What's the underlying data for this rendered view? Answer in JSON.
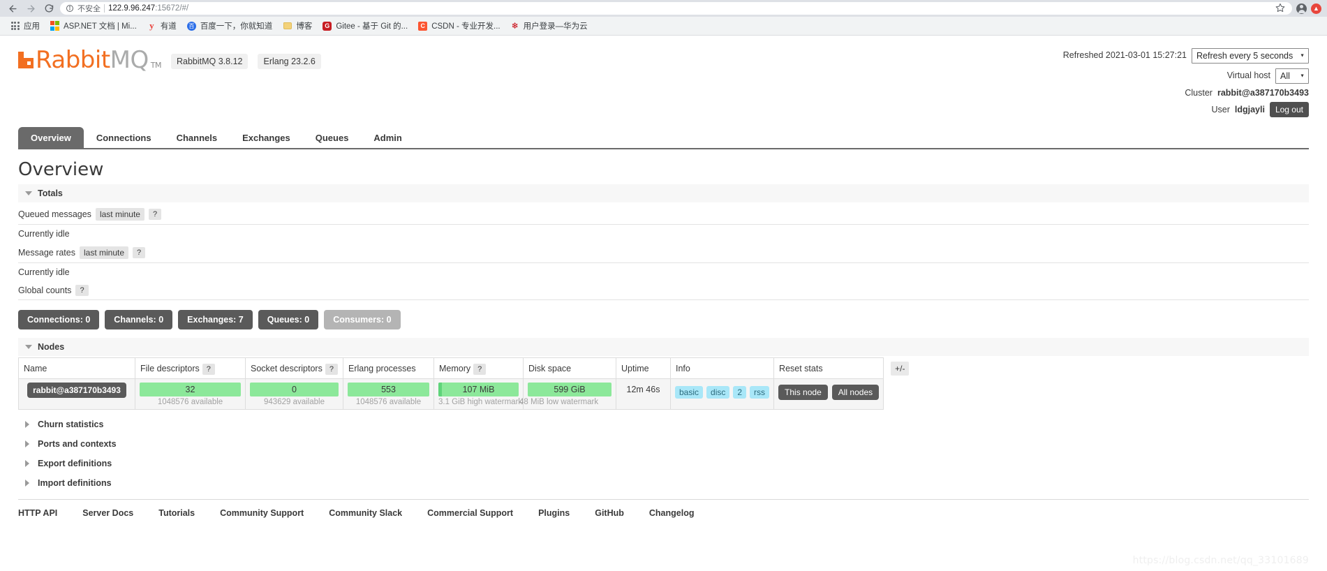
{
  "browser": {
    "back_icon": "back-arrow-icon",
    "forward_icon": "forward-arrow-icon",
    "reload_icon": "reload-icon",
    "security_label": "不安全",
    "url_host": "122.9.96.247",
    "url_rest": ":15672/#/",
    "star_icon": "bookmark-star-icon",
    "profile_icon": "profile-avatar-icon",
    "update_icon": "update-available-icon",
    "bookmarks": [
      {
        "label": "应用",
        "icon": "apps-grid-icon"
      },
      {
        "label": "ASP.NET 文档 | Mi...",
        "icon": "microsoft-icon"
      },
      {
        "label": "有道",
        "icon": "youdao-icon"
      },
      {
        "label": "百度一下，你就知道",
        "icon": "baidu-icon"
      },
      {
        "label": "博客",
        "icon": "folder-icon"
      },
      {
        "label": "Gitee - 基于 Git 的...",
        "icon": "gitee-icon"
      },
      {
        "label": "CSDN - 专业开发...",
        "icon": "csdn-icon"
      },
      {
        "label": "用户登录—华为云",
        "icon": "huawei-icon"
      }
    ]
  },
  "header": {
    "logo_orange": "Rabbit",
    "logo_gray": "MQ",
    "trademark": "TM",
    "version_pill": "RabbitMQ 3.8.12",
    "erlang_pill": "Erlang 23.2.6",
    "refreshed_label": "Refreshed 2021-03-01 15:27:21",
    "refresh_select_value": "Refresh every 5 seconds",
    "refresh_options": [
      "Refresh every 5 seconds"
    ],
    "vhost_label": "Virtual host",
    "vhost_value": "All",
    "vhost_options": [
      "All"
    ],
    "cluster_label": "Cluster",
    "cluster_value": "rabbit@a387170b3493",
    "user_label": "User",
    "user_value": "ldgjayli",
    "logout_label": "Log out"
  },
  "tabs": [
    {
      "label": "Overview",
      "active": true
    },
    {
      "label": "Connections",
      "active": false
    },
    {
      "label": "Channels",
      "active": false
    },
    {
      "label": "Exchanges",
      "active": false
    },
    {
      "label": "Queues",
      "active": false
    },
    {
      "label": "Admin",
      "active": false
    }
  ],
  "main": {
    "page_title": "Overview",
    "totals": {
      "section_label": "Totals",
      "queued_messages_label": "Queued messages",
      "queued_messages_chip": "last minute",
      "queued_messages_help": "?",
      "queued_messages_status": "Currently idle",
      "message_rates_label": "Message rates",
      "message_rates_chip": "last minute",
      "message_rates_help": "?",
      "message_rates_status": "Currently idle",
      "global_counts_label": "Global counts",
      "global_counts_help": "?"
    },
    "counts": [
      {
        "label": "Connections: 0",
        "disabled": false
      },
      {
        "label": "Channels: 0",
        "disabled": false
      },
      {
        "label": "Exchanges: 7",
        "disabled": false
      },
      {
        "label": "Queues: 0",
        "disabled": false
      },
      {
        "label": "Consumers: 0",
        "disabled": true
      }
    ],
    "nodes": {
      "section_label": "Nodes",
      "columns": {
        "name": "Name",
        "file_descriptors": "File descriptors",
        "file_descriptors_help": "?",
        "socket_descriptors": "Socket descriptors",
        "socket_descriptors_help": "?",
        "erlang_processes": "Erlang processes",
        "memory": "Memory",
        "memory_help": "?",
        "disk_space": "Disk space",
        "uptime": "Uptime",
        "info": "Info",
        "reset_stats": "Reset stats",
        "plusminus": "+/-"
      },
      "row": {
        "name": "rabbit@a387170b3493",
        "file_descriptors_value": "32",
        "file_descriptors_sub": "1048576 available",
        "socket_descriptors_value": "0",
        "socket_descriptors_sub": "943629 available",
        "erlang_processes_value": "553",
        "erlang_processes_sub": "1048576 available",
        "memory_value": "107 MiB",
        "memory_sub": "3.1 GiB high watermark",
        "disk_space_value": "599 GiB",
        "disk_space_sub": "48 MiB low watermark",
        "uptime_value": "12m 46s",
        "info_tags": [
          "basic",
          "disc",
          "2",
          "rss"
        ],
        "reset_this_node": "This node",
        "reset_all_nodes": "All nodes"
      }
    },
    "collapsed_sections": [
      {
        "label": "Churn statistics"
      },
      {
        "label": "Ports and contexts"
      },
      {
        "label": "Export definitions"
      },
      {
        "label": "Import definitions"
      }
    ]
  },
  "footer": {
    "links": [
      "HTTP API",
      "Server Docs",
      "Tutorials",
      "Community Support",
      "Community Slack",
      "Commercial Support",
      "Plugins",
      "GitHub",
      "Changelog"
    ]
  },
  "watermark": "https://blog.csdn.net/qq_33101689"
}
